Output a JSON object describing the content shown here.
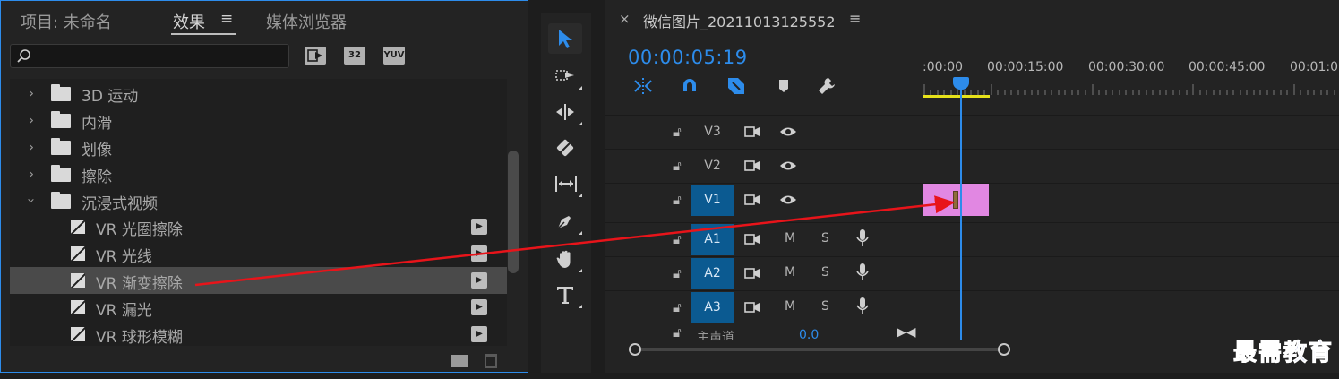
{
  "effects_panel": {
    "tabs": [
      {
        "label": "项目: 未命名"
      },
      {
        "label": "效果"
      },
      {
        "label": "媒体浏览器"
      }
    ],
    "menu_glyph": "≡",
    "search": {
      "placeholder": "",
      "value": ""
    },
    "filter_badges": [
      "",
      "32",
      "YUV"
    ],
    "folders": [
      {
        "label": "3D 运动",
        "expanded": false
      },
      {
        "label": "内滑",
        "expanded": false
      },
      {
        "label": "划像",
        "expanded": false
      },
      {
        "label": "擦除",
        "expanded": false
      },
      {
        "label": "沉浸式视频",
        "expanded": true
      }
    ],
    "effects": [
      {
        "label": "VR 光圈擦除"
      },
      {
        "label": "VR 光线"
      },
      {
        "label": "VR 渐变擦除",
        "selected": true
      },
      {
        "label": "VR 漏光"
      },
      {
        "label": "VR 球形模糊"
      }
    ]
  },
  "timeline": {
    "title": "微信图片_20211013125552",
    "close_glyph": "×",
    "menu_glyph": "≡",
    "timecode": "00:00:05:19",
    "ruler_labels": [
      ":00:00",
      "00:00:15:00",
      "00:00:30:00",
      "00:00:45:00",
      "00:01:0"
    ],
    "video_tracks": [
      {
        "name": "V3",
        "targeted": false
      },
      {
        "name": "V2",
        "targeted": false
      },
      {
        "name": "V1",
        "targeted": true
      }
    ],
    "audio_tracks": [
      {
        "name": "A1",
        "mute": "M",
        "solo": "S"
      },
      {
        "name": "A2",
        "mute": "M",
        "solo": "S"
      },
      {
        "name": "A3",
        "mute": "M",
        "solo": "S"
      }
    ],
    "master": {
      "label": "主声道",
      "value": "0.0"
    },
    "clip_color": "#e187e2",
    "accent_color": "#2d8ceb"
  },
  "watermark": "最需教育"
}
